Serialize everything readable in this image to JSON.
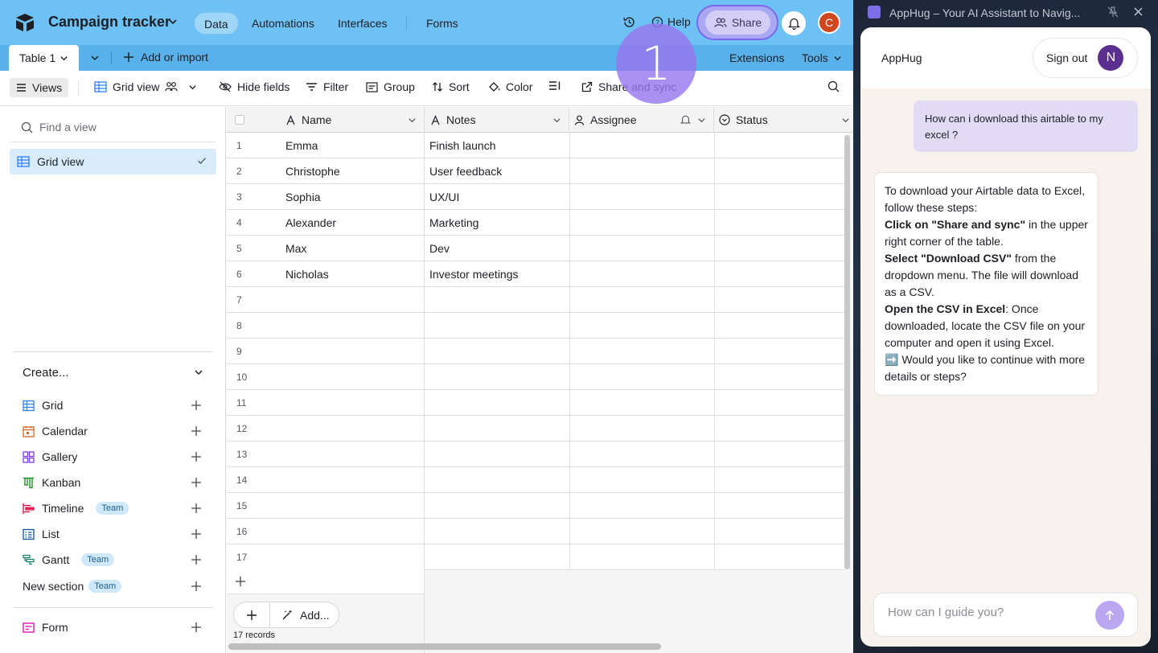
{
  "app": {
    "base_title": "Campaign tracker",
    "tabs": [
      {
        "label": "Data"
      },
      {
        "label": "Automations"
      },
      {
        "label": "Interfaces"
      },
      {
        "label": "Forms"
      }
    ],
    "help_label": "Help",
    "share_label": "Share",
    "avatar_initial": "C",
    "accent_color": "#6dc1f4"
  },
  "tabbar": {
    "table_tab": "Table 1",
    "add_import": "Add or import",
    "extensions": "Extensions",
    "tools": "Tools"
  },
  "viewbar": {
    "views": "Views",
    "grid_view": "Grid view",
    "hide_fields": "Hide fields",
    "filter": "Filter",
    "group": "Group",
    "sort": "Sort",
    "color": "Color",
    "share_sync": "Share and sync"
  },
  "step_badge": "1",
  "sidebar": {
    "find_placeholder": "Find a view",
    "active_view": "Grid view",
    "create_label": "Create...",
    "create_items": [
      {
        "label": "Grid",
        "icon": "grid-icon"
      },
      {
        "label": "Calendar",
        "icon": "calendar-icon"
      },
      {
        "label": "Gallery",
        "icon": "gallery-icon"
      },
      {
        "label": "Kanban",
        "icon": "kanban-icon"
      },
      {
        "label": "Timeline",
        "icon": "timeline-icon",
        "badge": "Team"
      },
      {
        "label": "List",
        "icon": "list-icon"
      },
      {
        "label": "Gantt",
        "icon": "gantt-icon",
        "badge": "Team"
      }
    ],
    "new_section": "New section",
    "new_section_badge": "Team",
    "form_label": "Form"
  },
  "grid": {
    "columns": [
      {
        "label": "Name",
        "icon": "text-field-icon"
      },
      {
        "label": "Notes",
        "icon": "text-field-icon"
      },
      {
        "label": "Assignee",
        "icon": "user-field-icon"
      },
      {
        "label": "Status",
        "icon": "status-field-icon"
      }
    ],
    "rows": [
      {
        "n": "1",
        "name": "Emma",
        "notes": "Finish launch"
      },
      {
        "n": "2",
        "name": "Christophe",
        "notes": "User feedback"
      },
      {
        "n": "3",
        "name": "Sophia",
        "notes": "UX/UI"
      },
      {
        "n": "4",
        "name": "Alexander",
        "notes": "Marketing"
      },
      {
        "n": "5",
        "name": "Max",
        "notes": "Dev"
      },
      {
        "n": "6",
        "name": "Nicholas",
        "notes": "Investor meetings"
      },
      {
        "n": "7",
        "name": "",
        "notes": ""
      },
      {
        "n": "8",
        "name": "",
        "notes": ""
      },
      {
        "n": "9",
        "name": "",
        "notes": ""
      },
      {
        "n": "10",
        "name": "",
        "notes": ""
      },
      {
        "n": "11",
        "name": "",
        "notes": ""
      },
      {
        "n": "12",
        "name": "",
        "notes": ""
      },
      {
        "n": "13",
        "name": "",
        "notes": ""
      },
      {
        "n": "14",
        "name": "",
        "notes": ""
      },
      {
        "n": "15",
        "name": "",
        "notes": ""
      },
      {
        "n": "16",
        "name": "",
        "notes": ""
      },
      {
        "n": "17",
        "name": "",
        "notes": ""
      }
    ],
    "add_label": "Add...",
    "record_count": "17 records"
  },
  "extension": {
    "window_title": "AppHug – Your AI Assistant to Navig...",
    "name": "AppHug",
    "sign_out": "Sign out",
    "user_initial": "N",
    "user_message": "How can i download this airtable to my excel ?",
    "bot": {
      "intro": "To download your Airtable data to Excel, follow these steps:",
      "step1_bold": "Click on \"Share and sync\"",
      "step1_rest": " in the upper right corner of the table.",
      "step2_bold": "Select \"Download CSV\"",
      "step2_rest": " from the dropdown menu. The file will download as a CSV.",
      "step3_bold": "Open the CSV in Excel",
      "step3_rest": ": Once downloaded, locate the CSV file on your computer and open it using Excel.",
      "followup": "➡️ Would you like to continue with more details or steps?"
    },
    "input_placeholder": "How can I guide you?"
  }
}
